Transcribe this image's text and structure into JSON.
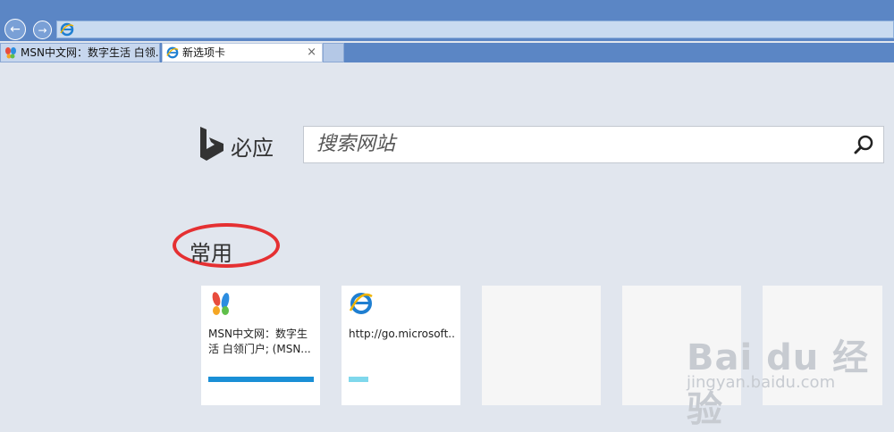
{
  "browser": {
    "tabs": [
      {
        "title": "MSN中文网：数字生活 白领..."
      },
      {
        "title": "新选项卡",
        "close": "×"
      }
    ]
  },
  "search": {
    "brand": "必应",
    "placeholder": "搜索网站"
  },
  "section": {
    "title": "常用"
  },
  "tiles": [
    {
      "text": "MSN中文网：数字生活 白领门户; (MSN...",
      "accent": "#1a8fd6"
    },
    {
      "text": "http://go.microsoft....",
      "accent": "#7fd8ec"
    },
    {
      "text": ""
    },
    {
      "text": ""
    },
    {
      "text": ""
    }
  ],
  "watermark": {
    "brand": "Bai du 经验",
    "sub": "jingyan.baidu.com"
  },
  "colors": {
    "topbar": "#5b86c5",
    "page_bg": "#e1e6ee",
    "highlight": "#e53032"
  }
}
